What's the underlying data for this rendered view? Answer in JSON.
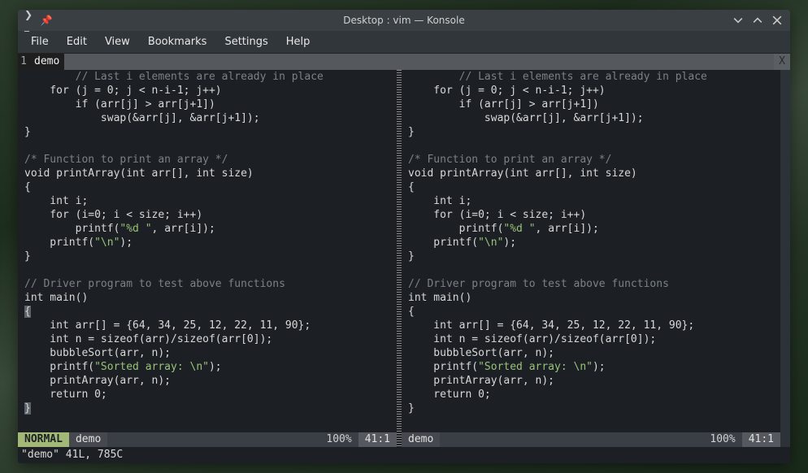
{
  "titlebar": {
    "title": "Desktop : vim — Konsole"
  },
  "menubar": {
    "items": [
      "File",
      "Edit",
      "View",
      "Bookmarks",
      "Settings",
      "Help"
    ]
  },
  "tabbar": {
    "number": "1",
    "name": "demo",
    "close": "X"
  },
  "code": {
    "l0a": "        ",
    "l0b": "// Last i elements are already in place",
    "l1": "    for (j = 0; j < n-i-1; j++)",
    "l2": "        if (arr[j] > arr[j+1])",
    "l3": "            swap(&arr[j], &arr[j+1]);",
    "l4": "}",
    "l5": "",
    "l6": "/* Function to print an array */",
    "l7": "void printArray(int arr[], int size)",
    "l8": "{",
    "l9": "    int i;",
    "l10": "    for (i=0; i < size; i++)",
    "l11a": "        printf(",
    "l11b": "\"%d \"",
    "l11c": ", arr[i]);",
    "l12a": "    printf(",
    "l12b": "\"\\n\"",
    "l12c": ");",
    "l13": "}",
    "l14": "",
    "l15": "// Driver program to test above functions",
    "l16": "int main()",
    "l17": "{",
    "l18": "    int arr[] = {64, 34, 25, 12, 22, 11, 90};",
    "l19": "    int n = sizeof(arr)/sizeof(arr[0]);",
    "l20": "    bubbleSort(arr, n);",
    "l21a": "    printf(",
    "l21b": "\"Sorted array: \\n\"",
    "l21c": ");",
    "l22": "    printArray(arr, n);",
    "l23": "    return 0;",
    "l24": "}",
    "curL": "{",
    "curR": "}"
  },
  "status": {
    "left": {
      "mode": " NORMAL ",
      "file": "demo",
      "pct": "100%",
      "pos": "41:1"
    },
    "right": {
      "file": "demo",
      "pct": "100%",
      "pos": "41:1"
    }
  },
  "cmdline": "\"demo\" 41L, 785C"
}
